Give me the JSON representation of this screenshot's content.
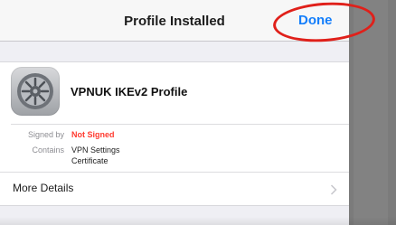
{
  "navbar": {
    "title": "Profile Installed",
    "done_label": "Done"
  },
  "profile": {
    "icon": "settings-gear-icon",
    "name": "VPNUK IKEv2 Profile"
  },
  "details": {
    "signed_by_label": "Signed by",
    "signed_by_value": "Not Signed",
    "contains_label": "Contains",
    "contains_values": [
      "VPN Settings",
      "Certificate"
    ]
  },
  "more_details": {
    "label": "More Details",
    "icon": "chevron-right-icon"
  },
  "colors": {
    "accent": "#147efb",
    "warning": "#ff3b30",
    "annotation": "#e0201a"
  }
}
